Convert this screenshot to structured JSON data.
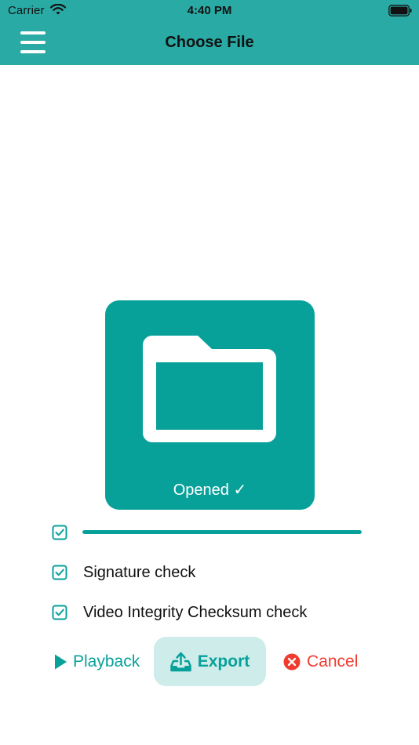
{
  "status_bar": {
    "carrier": "Carrier",
    "time": "4:40 PM"
  },
  "header": {
    "title": "Choose File"
  },
  "file_card": {
    "status": "Opened ✓",
    "icon": "folder-icon"
  },
  "checks": [
    {
      "label": "",
      "checked": true
    },
    {
      "label": "Signature check",
      "checked": true
    },
    {
      "label": "Video Integrity Checksum check",
      "checked": true
    }
  ],
  "progress": {
    "value": 1.0
  },
  "actions": {
    "playback": "Playback",
    "export": "Export",
    "cancel": "Cancel"
  },
  "colors": {
    "header": "#2aaaa5",
    "accent": "#08a19a",
    "accent_light": "#cdecea",
    "danger": "#f13b2f"
  }
}
